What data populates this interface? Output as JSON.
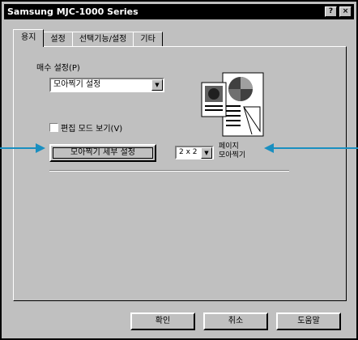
{
  "window": {
    "title": "Samsung MJC-1000 Series"
  },
  "tabs": [
    {
      "label": "용지",
      "active": true
    },
    {
      "label": "설정",
      "active": false
    },
    {
      "label": "선택기능/설정",
      "active": false
    },
    {
      "label": "기타",
      "active": false
    }
  ],
  "copies": {
    "label": "매수 설정(P)"
  },
  "layout_select": {
    "value": "모아찍기 설정"
  },
  "checkbox": {
    "label": "편집 모드 보기(V)",
    "checked": false
  },
  "detail_button": {
    "label": "모아찍기 세부 설정"
  },
  "pages_select": {
    "value": "2 x 2"
  },
  "pages_label": {
    "line1": "페이지",
    "line2": "모아찍기"
  },
  "buttons": {
    "ok": "확인",
    "cancel": "취소",
    "help": "도움말"
  },
  "colors": {
    "callout_arrow": "#1a8fc0",
    "titlebar": "#000000",
    "face": "#c0c0c0"
  },
  "icons": {
    "close": "close-icon",
    "help": "help-icon",
    "dropdown": "chevron-down-icon"
  }
}
